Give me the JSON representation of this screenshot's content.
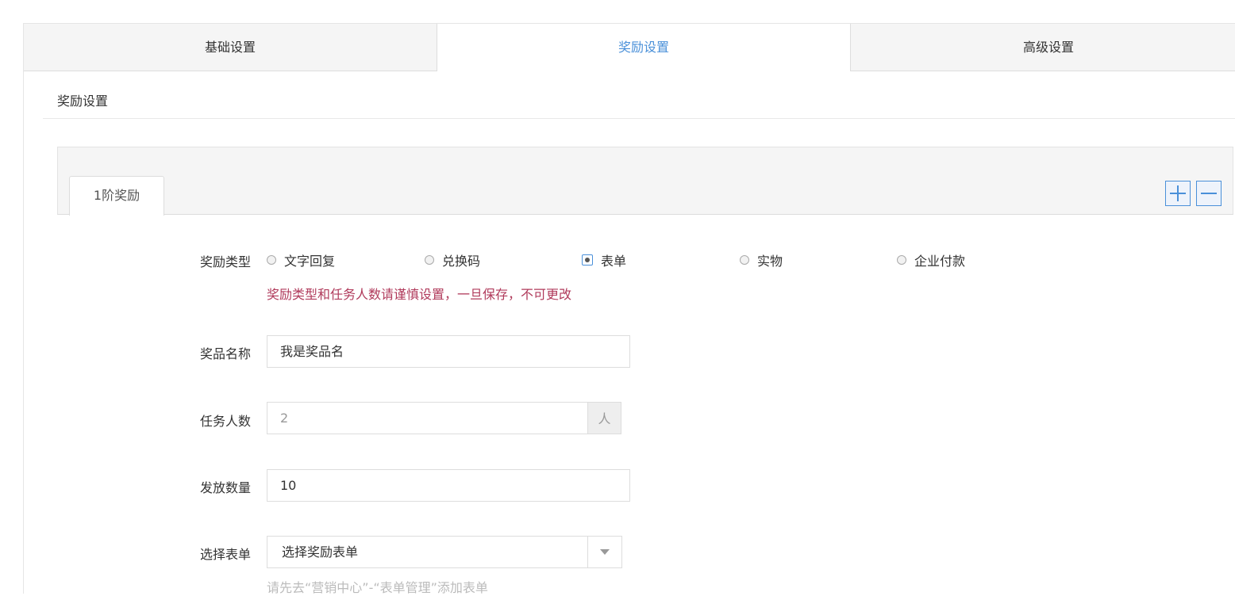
{
  "tabs": [
    {
      "label": "基础设置",
      "active": false
    },
    {
      "label": "奖励设置",
      "active": true
    },
    {
      "label": "高级设置",
      "active": false
    }
  ],
  "section": {
    "title": "奖励设置"
  },
  "tier": {
    "tab_label": "1阶奖励",
    "add_icon": "plus-icon",
    "remove_icon": "minus-icon"
  },
  "reward_type": {
    "label": "奖励类型",
    "options": [
      "文字回复",
      "兑换码",
      "表单",
      "实物",
      "企业付款"
    ],
    "selected": "表单",
    "warning": "奖励类型和任务人数请谨慎设置，一旦保存，不可更改"
  },
  "prize_name": {
    "label": "奖品名称",
    "value": "我是奖品名"
  },
  "task_count": {
    "label": "任务人数",
    "value": "2",
    "unit": "人"
  },
  "quantity": {
    "label": "发放数量",
    "value": "10"
  },
  "form_select": {
    "label": "选择表单",
    "selected": "选择奖励表单",
    "hint": "请先去“营销中心”-“表单管理”添加表单"
  },
  "colors": {
    "accent": "#4a90d9",
    "warning": "#b03a5b",
    "panel_bg": "#f5f5f5"
  }
}
